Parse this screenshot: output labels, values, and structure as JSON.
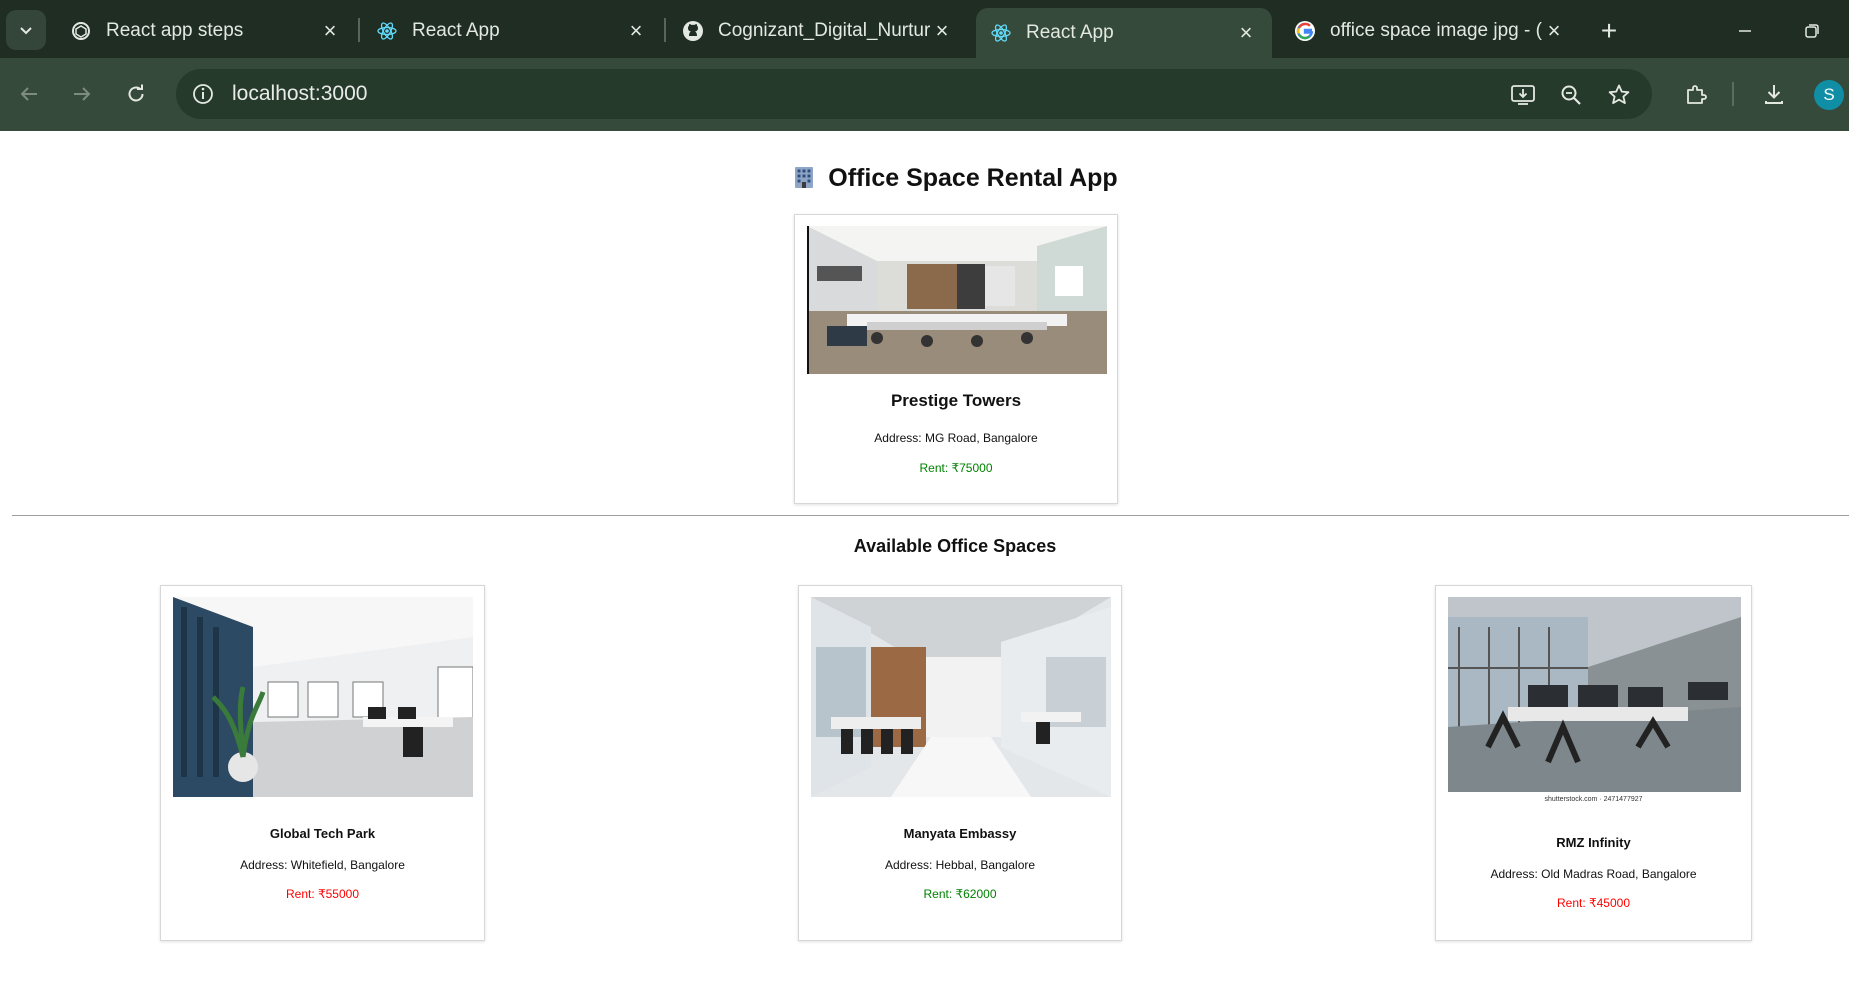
{
  "browser": {
    "tabs": [
      {
        "label": "React app steps",
        "icon": "chatgpt-icon",
        "active": false
      },
      {
        "label": "React App",
        "icon": "react-icon",
        "active": false
      },
      {
        "label": "Cognizant_Digital_Nurtur",
        "icon": "github-icon",
        "active": false
      },
      {
        "label": "React App",
        "icon": "react-icon",
        "active": true
      },
      {
        "label": "office space image jpg - (",
        "icon": "google-icon",
        "active": false
      }
    ],
    "url": "localhost:3000",
    "profile_initial": "S"
  },
  "page": {
    "title": "Office Space Rental App",
    "title_emoji": "office-building-icon",
    "section_title": "Available Office Spaces"
  },
  "featured": {
    "name": "Prestige Towers",
    "address": "Address: MG Road, Bangalore",
    "rent": "Rent: ₹75000",
    "rent_color": "#008000"
  },
  "offices": [
    {
      "name": "Global Tech Park",
      "address": "Address: Whitefield, Bangalore",
      "rent": "Rent: ₹55000",
      "rent_color": "#ff0000"
    },
    {
      "name": "Manyata Embassy",
      "address": "Address: Hebbal, Bangalore",
      "rent": "Rent: ₹62000",
      "rent_color": "#008000"
    },
    {
      "name": "RMZ Infinity",
      "address": "Address: Old Madras Road, Bangalore",
      "rent": "Rent: ₹45000",
      "rent_color": "#ff0000",
      "image_caption": "shutterstock.com · 2471477927"
    }
  ],
  "colors": {
    "chrome_dark": "#1f2d22",
    "chrome_toolbar": "#354a3a",
    "rent_high": "#008000",
    "rent_low": "#ff0000"
  }
}
